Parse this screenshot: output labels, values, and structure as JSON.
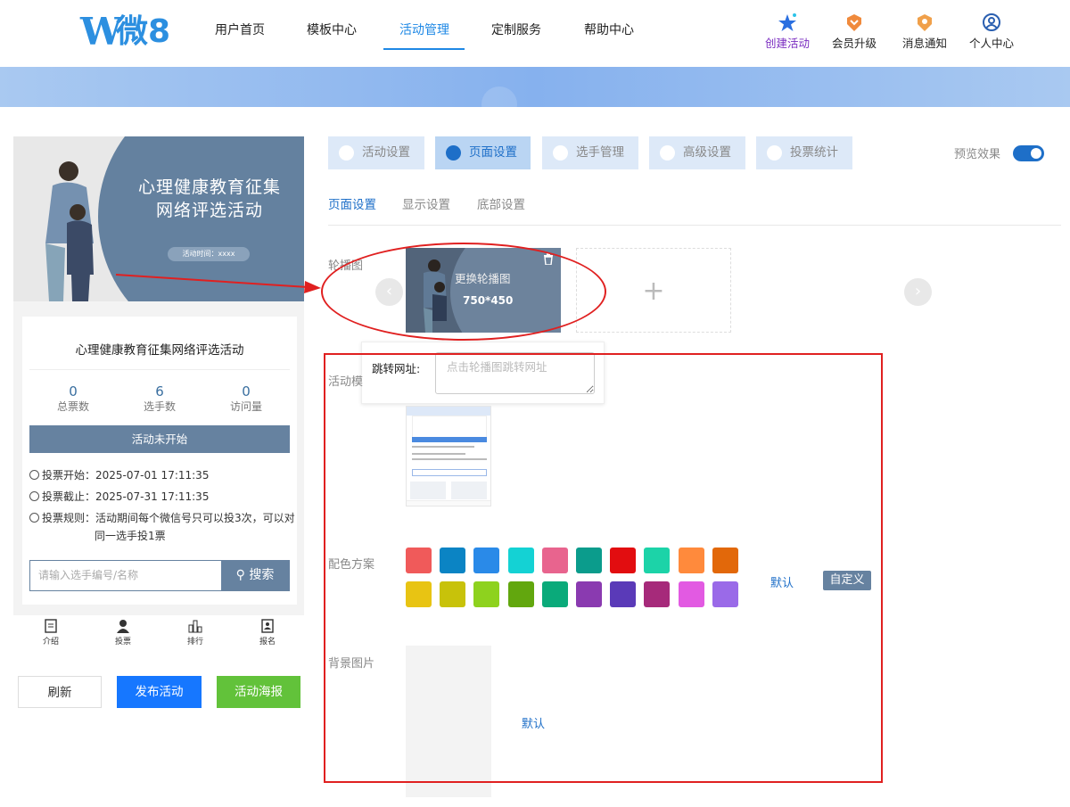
{
  "nav": {
    "logo_text": "微8",
    "menu": [
      "用户首页",
      "模板中心",
      "活动管理",
      "定制服务",
      "帮助中心"
    ],
    "active_menu": "活动管理",
    "right": [
      {
        "label": "创建活动",
        "icon": "star-icon"
      },
      {
        "label": "会员升级",
        "icon": "vip-icon"
      },
      {
        "label": "消息通知",
        "icon": "bell-icon"
      },
      {
        "label": "个人中心",
        "icon": "user-icon"
      }
    ]
  },
  "preview": {
    "poster_title_line1": "心理健康教育征集",
    "poster_title_line2": "网络评选活动",
    "poster_time": "活动时间：xxxx",
    "activity_title": "心理健康教育征集网络评选活动",
    "stats": [
      {
        "value": "0",
        "label": "总票数"
      },
      {
        "value": "6",
        "label": "选手数"
      },
      {
        "value": "0",
        "label": "访问量"
      }
    ],
    "status": "活动未开始",
    "vote_start": "投票开始：2025-07-01 17:11:35",
    "vote_end": "投票截止：2025-07-31 17:11:35",
    "rule_line1": "投票规则：活动期间每个微信号只可以投3次，可以对",
    "rule_line2": "同一选手投1票",
    "search_placeholder": "请输入选手编号/名称",
    "search_button": "搜索",
    "bottom_nav": [
      "介绍",
      "投票",
      "排行",
      "报名"
    ]
  },
  "actions": {
    "refresh": "刷新",
    "publish": "发布活动",
    "poster": "活动海报"
  },
  "tabs": [
    "活动设置",
    "页面设置",
    "选手管理",
    "高级设置",
    "投票统计"
  ],
  "active_tab": "页面设置",
  "preview_label": "预览效果",
  "subtabs": [
    "页面设置",
    "显示设置",
    "底部设置"
  ],
  "carousel": {
    "label": "轮播图",
    "overlay_replace": "更换轮播图",
    "overlay_size": "750*450",
    "add": "+"
  },
  "jump_popover": {
    "label": "跳转网址:",
    "placeholder": "点击轮播图跳转网址"
  },
  "template_label": "活动模",
  "color_scheme": {
    "label": "配色方案",
    "row1": [
      "#f05a5a",
      "#0b84c4",
      "#2a8ae8",
      "#14d2d4",
      "#e8648e",
      "#0b9c8c",
      "#e20d10",
      "#1cd3a8",
      "#ff8a3c",
      "#e2680a"
    ],
    "row2": [
      "#e8c413",
      "#c8c20a",
      "#8ed21e",
      "#62a70e",
      "#0aaa7a",
      "#8a3ab0",
      "#5a3ab8",
      "#a62a7a",
      "#e25ae2",
      "#9a6ae8"
    ],
    "default": "默认",
    "custom": "自定义"
  },
  "background": {
    "label": "背景图片",
    "default": "默认"
  }
}
